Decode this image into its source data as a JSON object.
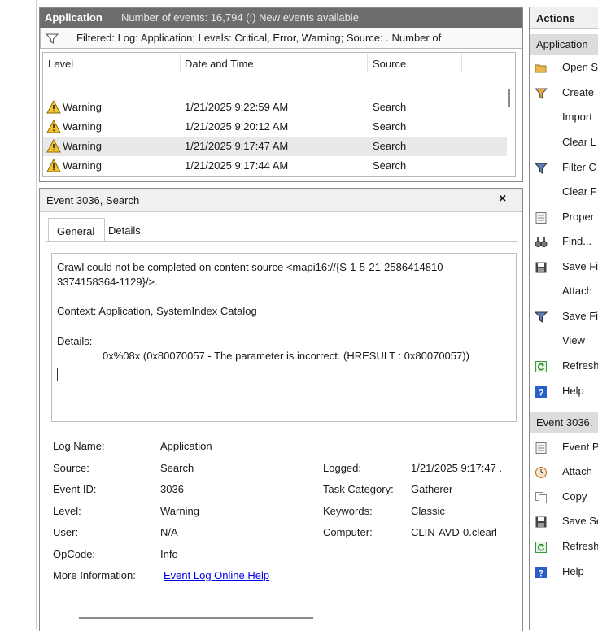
{
  "events": {
    "log_name": "Application",
    "count_text": "Number of events: 16,794 (!) New events available",
    "filter_text": "Filtered: Log: Application; Levels: Critical, Error, Warning; Source: . Number of",
    "columns": [
      "Level",
      "Date and Time",
      "Source"
    ],
    "rows": [
      {
        "level": "Warning",
        "date": "1/21/2025 9:22:59 AM",
        "source": "Search"
      },
      {
        "level": "Warning",
        "date": "1/21/2025 9:20:12 AM",
        "source": "Search"
      },
      {
        "level": "Warning",
        "date": "1/21/2025 9:17:47 AM",
        "source": "Search"
      },
      {
        "level": "Warning",
        "date": "1/21/2025 9:17:44 AM",
        "source": "Search"
      }
    ]
  },
  "detail": {
    "title": "Event 3036, Search",
    "close": "×",
    "tabs": [
      "General",
      "Details"
    ],
    "desc_line1": "Crawl could not be completed on content source <mapi16://{S-1-5-21-2586414810-",
    "desc_line2": "3374158364-1129}/>.",
    "desc_line3": "Context:  Application, SystemIndex Catalog",
    "desc_line4": "Details:",
    "desc_line5": "0x%08x (0x80070057 - The parameter is incorrect.  (HRESULT : 0x80070057))",
    "props": {
      "log_name_label": "Log Name:",
      "log_name_value": "Application",
      "source_label": "Source:",
      "source_value": "Search",
      "event_id_label": "Event ID:",
      "event_id_value": "3036",
      "level_label": "Level:",
      "level_value": "Warning",
      "user_label": "User:",
      "user_value": "N/A",
      "opcode_label": "OpCode:",
      "opcode_value": "Info",
      "more_info_label": "More Information:",
      "more_info_link": "Event Log Online Help",
      "logged_label": "Logged:",
      "logged_value": "1/21/2025 9:17:47 .",
      "task_label": "Task Category:",
      "task_value": "Gatherer",
      "keywords_label": "Keywords:",
      "keywords_value": "Classic",
      "computer_label": "Computer:",
      "computer_value": "CLIN-AVD-0.clearl"
    }
  },
  "actions": {
    "title": "Actions",
    "section1": "Application",
    "items1": [
      "Open S",
      "Create",
      "Import",
      "Clear L",
      "Filter C",
      "Clear F",
      "Proper",
      "Find...",
      "Save Fi",
      "Attach",
      "Save Fi",
      "View",
      "Refresh",
      "Help"
    ],
    "section2": "Event 3036,",
    "items2": [
      "Event P",
      "Attach",
      "Copy",
      "Save Se",
      "Refresh",
      "Help"
    ]
  },
  "colors": {
    "header_bg": "#6d6d6d",
    "warning": "#f2c230",
    "link": "#0000ee",
    "section_bg": "#dcdcdc"
  }
}
